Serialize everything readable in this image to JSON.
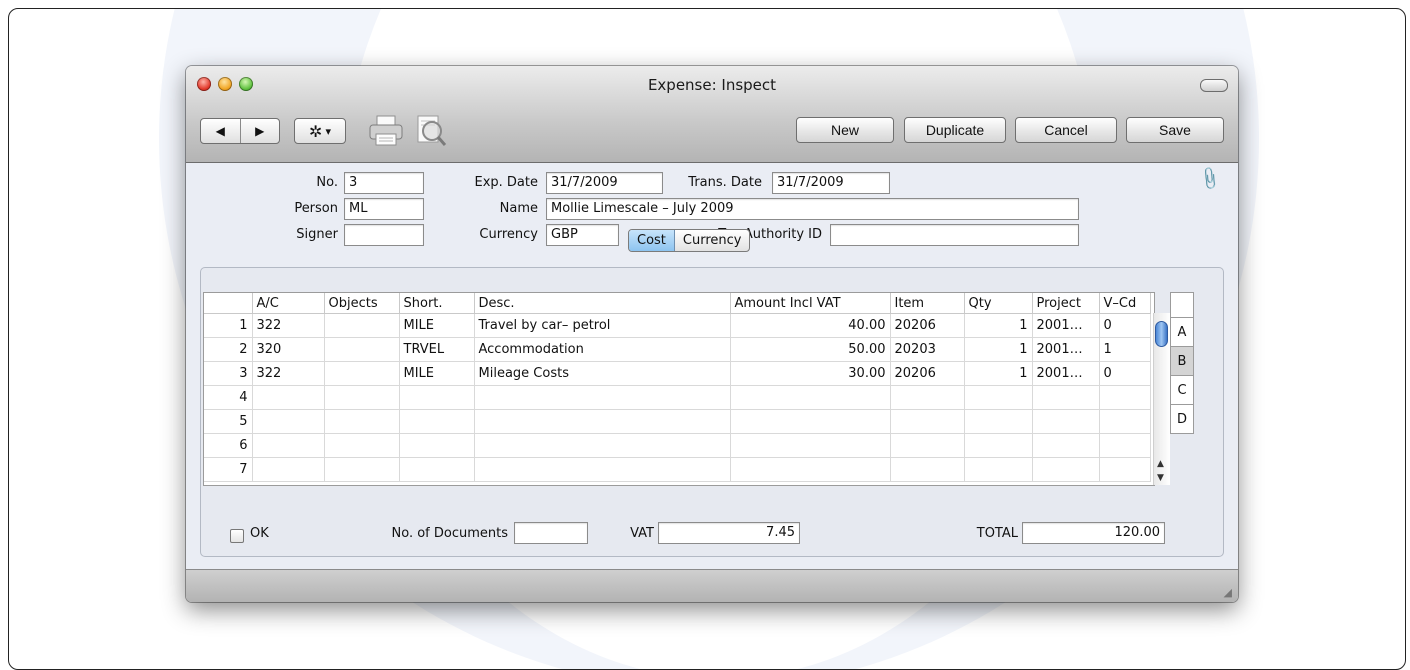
{
  "window": {
    "title": "Expense: Inspect"
  },
  "toolbar": {
    "prev_symbol": "◀",
    "next_symbol": "▶",
    "gear_symbol": "✲",
    "gear_caret": "▾",
    "buttons": {
      "new": "New",
      "duplicate": "Duplicate",
      "cancel": "Cancel",
      "save": "Save"
    }
  },
  "header": {
    "no_label": "No.",
    "no_value": "3",
    "exp_date_label": "Exp. Date",
    "exp_date_value": "31/7/2009",
    "trans_date_label": "Trans. Date",
    "trans_date_value": "31/7/2009",
    "person_label": "Person",
    "person_value": "ML",
    "name_label": "Name",
    "name_value": "Mollie Limescale – July 2009",
    "signer_label": "Signer",
    "signer_value": "",
    "currency_label": "Currency",
    "currency_value": "GBP",
    "tax_authority_label": "Tax Authority ID",
    "tax_authority_value": ""
  },
  "tabs": [
    {
      "label": "Cost",
      "selected": true
    },
    {
      "label": "Currency",
      "selected": false
    }
  ],
  "grid": {
    "columns": [
      "",
      "A/C",
      "Objects",
      "Short.",
      "Desc.",
      "Amount Incl VAT",
      "Item",
      "Qty",
      "Project",
      "V–Cd"
    ],
    "rows": [
      {
        "n": "1",
        "ac": "322",
        "objects": "",
        "short": "MILE",
        "desc": "Travel by car– petrol",
        "amount": "40.00",
        "item": "20206",
        "qty": "1",
        "project": "2001…",
        "vcd": "0"
      },
      {
        "n": "2",
        "ac": "320",
        "objects": "",
        "short": "TRVEL",
        "desc": "Accommodation",
        "amount": "50.00",
        "item": "20203",
        "qty": "1",
        "project": "2001…",
        "vcd": "1"
      },
      {
        "n": "3",
        "ac": "322",
        "objects": "",
        "short": "MILE",
        "desc": "Mileage Costs",
        "amount": "30.00",
        "item": "20206",
        "qty": "1",
        "project": "2001…",
        "vcd": "0"
      },
      {
        "n": "4",
        "ac": "",
        "objects": "",
        "short": "",
        "desc": "",
        "amount": "",
        "item": "",
        "qty": "",
        "project": "",
        "vcd": ""
      },
      {
        "n": "5",
        "ac": "",
        "objects": "",
        "short": "",
        "desc": "",
        "amount": "",
        "item": "",
        "qty": "",
        "project": "",
        "vcd": ""
      },
      {
        "n": "6",
        "ac": "",
        "objects": "",
        "short": "",
        "desc": "",
        "amount": "",
        "item": "",
        "qty": "",
        "project": "",
        "vcd": ""
      },
      {
        "n": "7",
        "ac": "",
        "objects": "",
        "short": "",
        "desc": "",
        "amount": "",
        "item": "",
        "qty": "",
        "project": "",
        "vcd": ""
      }
    ],
    "side_tabs": [
      "A",
      "B",
      "C",
      "D"
    ],
    "selected_side_tab": "B",
    "scroll_up_symbol": "▲",
    "scroll_down_symbol": "▼"
  },
  "footer": {
    "ok_label": "OK",
    "no_documents_label": "No. of Documents",
    "no_documents_value": "",
    "vat_label": "VAT",
    "vat_value": "7.45",
    "total_label": "TOTAL",
    "total_value": "120.00"
  },
  "colors": {
    "selected_tab": "#8dc4f0",
    "scroll_thumb": "#4b87d6"
  }
}
